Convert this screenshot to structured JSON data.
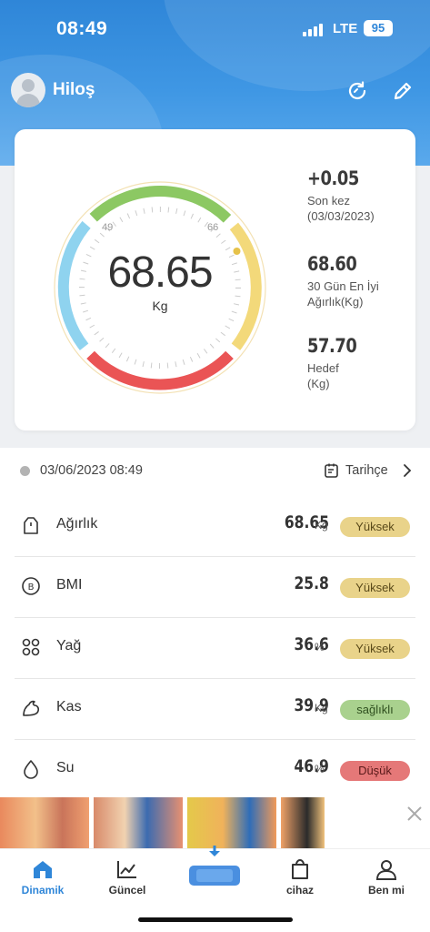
{
  "status_bar": {
    "time": "08:49",
    "network": "LTE",
    "battery": "95"
  },
  "header": {
    "username": "Hiloş",
    "refresh_icon": "refresh-icon",
    "edit_icon": "edit-icon"
  },
  "gauge": {
    "value": "68.65",
    "unit": "Kg",
    "low_mark": "49",
    "high_mark": "66",
    "level": 68.65,
    "colors": {
      "green": "#8cc863",
      "yellow": "#f3d97a",
      "red": "#ea5455",
      "blue": "#8fd3ef"
    }
  },
  "stats": [
    {
      "value": "+0.05",
      "label": "Son kez\n(03/03/2023)"
    },
    {
      "value": "68.60",
      "label": "30 Gün En İyi\nAğırlık(Kg)"
    },
    {
      "value": "57.70",
      "label": "Hedef\n(Kg)"
    }
  ],
  "date_line": {
    "datetime": "03/06/2023 08:49",
    "history_label": "Tarihçe"
  },
  "metrics": [
    {
      "name": "Ağırlık",
      "value": "68.65",
      "unit": "Kg",
      "status": "Yüksek",
      "icon": "weight-icon",
      "badge_color": "#e9d38a"
    },
    {
      "name": "BMI",
      "value": "25.8",
      "unit": "",
      "status": "Yüksek",
      "icon": "bmi-icon",
      "badge_color": "#e9d38a"
    },
    {
      "name": "Yağ",
      "value": "36.6",
      "unit": "%",
      "status": "Yüksek",
      "icon": "fat-icon",
      "badge_color": "#e9d38a"
    },
    {
      "name": "Kas",
      "value": "39.9",
      "unit": "Kg",
      "status": "sağlıklı",
      "icon": "muscle-icon",
      "badge_color": "#a9d18e"
    },
    {
      "name": "Su",
      "value": "46.9",
      "unit": "%",
      "status": "Düşük",
      "icon": "water-icon",
      "badge_color": "#e57878"
    }
  ],
  "tabs": [
    {
      "label": "Dinamik",
      "icon": "home-icon",
      "active": true
    },
    {
      "label": "Güncel",
      "icon": "chart-icon",
      "active": false
    },
    {
      "label": "",
      "icon": "scale-icon",
      "active": false
    },
    {
      "label": "cihaz",
      "icon": "device-bag-icon",
      "active": false
    },
    {
      "label": "Ben mi",
      "icon": "profile-icon",
      "active": false
    }
  ],
  "accent_color": "#2f86d8"
}
